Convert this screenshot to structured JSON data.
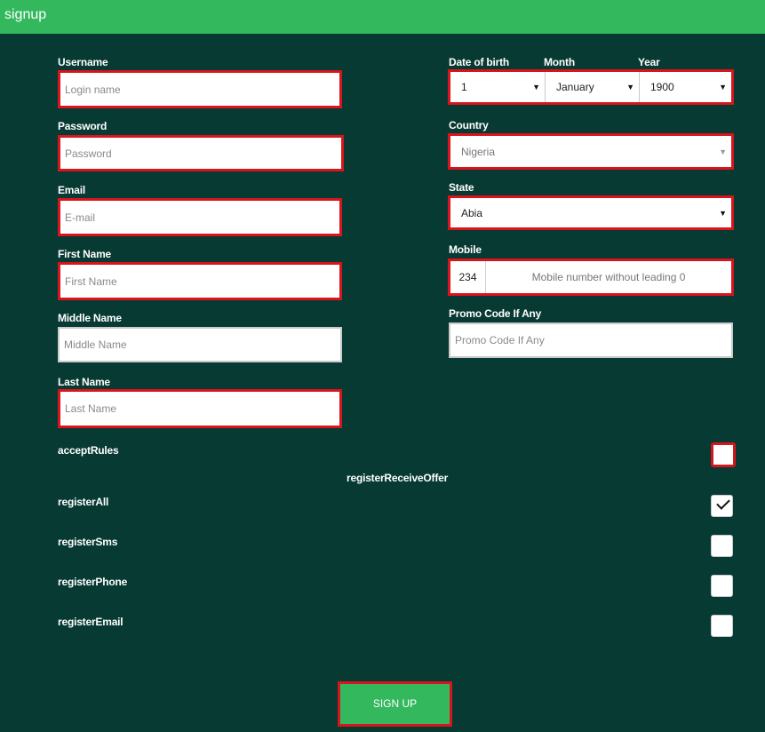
{
  "window": {
    "title": "signup"
  },
  "form": {
    "username": {
      "label": "Username",
      "placeholder": "Login name"
    },
    "password": {
      "label": "Password",
      "placeholder": "Password"
    },
    "email": {
      "label": "Email",
      "placeholder": "E-mail"
    },
    "first_name": {
      "label": "First Name",
      "placeholder": "First Name"
    },
    "middle_name": {
      "label": "Middle Name",
      "placeholder": "Middle Name"
    },
    "last_name": {
      "label": "Last Name",
      "placeholder": "Last Name"
    },
    "dob": {
      "label": "Date of birth",
      "day_value": "1",
      "month_label": "Month",
      "month_value": "January",
      "year_label": "Year",
      "year_value": "1900"
    },
    "country": {
      "label": "Country",
      "value": "Nigeria"
    },
    "state": {
      "label": "State",
      "value": "Abia"
    },
    "mobile": {
      "label": "Mobile",
      "code": "234",
      "placeholder": "Mobile number without leading 0"
    },
    "promo": {
      "label": "Promo Code If Any",
      "placeholder": "Promo Code If Any"
    }
  },
  "checks": {
    "accept_rules": "acceptRules",
    "receive_offer_header": "registerReceiveOffer",
    "register_all": "registerAll",
    "register_sms": "registerSms",
    "register_phone": "registerPhone",
    "register_email": "registerEmail",
    "register_all_checked": true
  },
  "actions": {
    "signup": "SIGN UP"
  },
  "colors": {
    "background": "#063a33",
    "header": "#34b85e",
    "error_border": "#d8141c",
    "button": "#34b85e"
  },
  "icons": {
    "select_arrow": "triangle-down-icon",
    "checkmark": "check-icon"
  }
}
